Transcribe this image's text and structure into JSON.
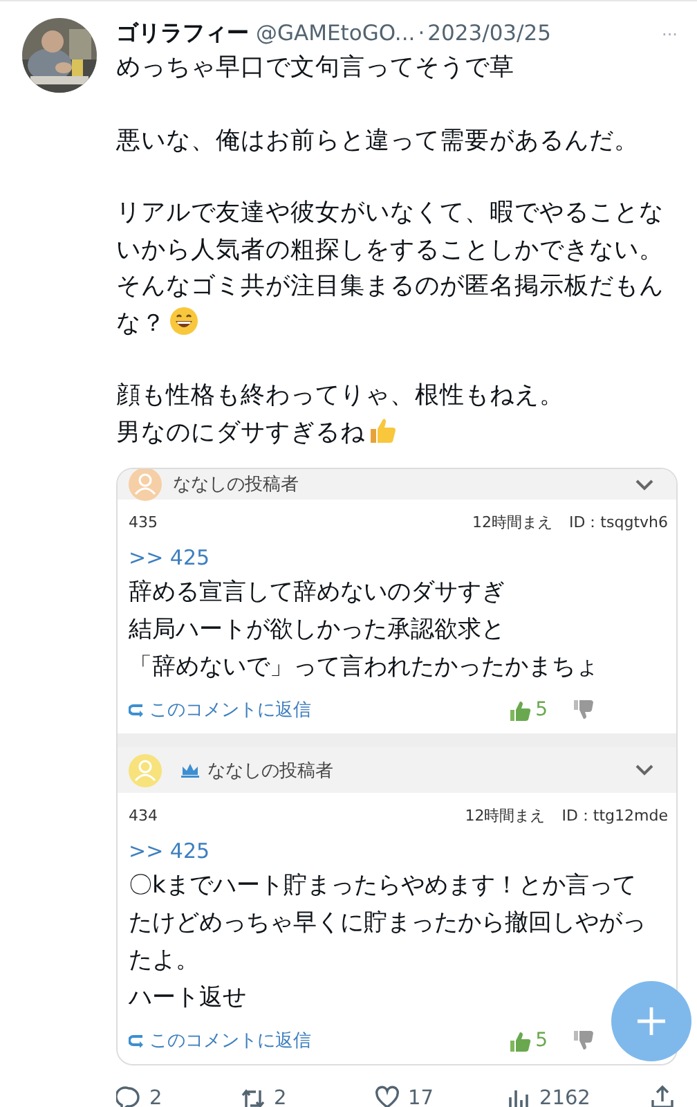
{
  "tweet": {
    "author": "ゴリラフィー",
    "handle": "@GAMEtoGO...",
    "separator": "·",
    "date": "2023/03/25",
    "more": "···",
    "paragraphs": [
      {
        "kind": "plain",
        "lines": [
          "めっちゃ早口で文句言ってそうで草"
        ]
      },
      {
        "kind": "plain",
        "lines": [
          "悪いな、俺はお前らと違って需要があるんだ。"
        ]
      },
      {
        "kind": "smile",
        "lines": [
          "リアルで友達や彼女がいなくて、暇でやることないから人気者の粗探しをすることしかできない。そんなゴミ共が注目集まるのが匿名掲示板だもん",
          "な？"
        ]
      },
      {
        "kind": "thumbs",
        "lines": [
          "顔も性格も終わってりゃ、根性もねえ。",
          "男なのにダサすぎるね"
        ]
      }
    ]
  },
  "comments": [
    {
      "author": "ななしの投稿者",
      "color": "#f6cfa6",
      "badge": false,
      "number": "435",
      "time": "12時間まえ",
      "id": "ID：tsqgtvh6",
      "reply_to": ">> 425",
      "lines": [
        "辞める宣言して辞めないのダサすぎ",
        "結局ハートが欲しかった承認欲求と",
        "「辞めないで」って言われたかったかまちょ"
      ],
      "reply_link": "このコメントに返信",
      "likes": "5"
    },
    {
      "author": "ななしの投稿者",
      "color": "#f7e27c",
      "badge": true,
      "number": "434",
      "time": "12時間まえ",
      "id": "ID：ttg12mde",
      "reply_to": ">> 425",
      "lines": [
        "〇kまでハート貯まったらやめます！とか言ってたけどめっちゃ早くに貯まったから撤回しやがったよ。",
        "ハート返せ"
      ],
      "reply_link": "このコメントに返信",
      "likes": "5"
    }
  ],
  "actions": [
    {
      "kind": "reply",
      "count": "2"
    },
    {
      "kind": "retweet",
      "count": "2"
    },
    {
      "kind": "like",
      "count": "17"
    },
    {
      "kind": "views",
      "count": "2162"
    },
    {
      "kind": "share"
    }
  ]
}
